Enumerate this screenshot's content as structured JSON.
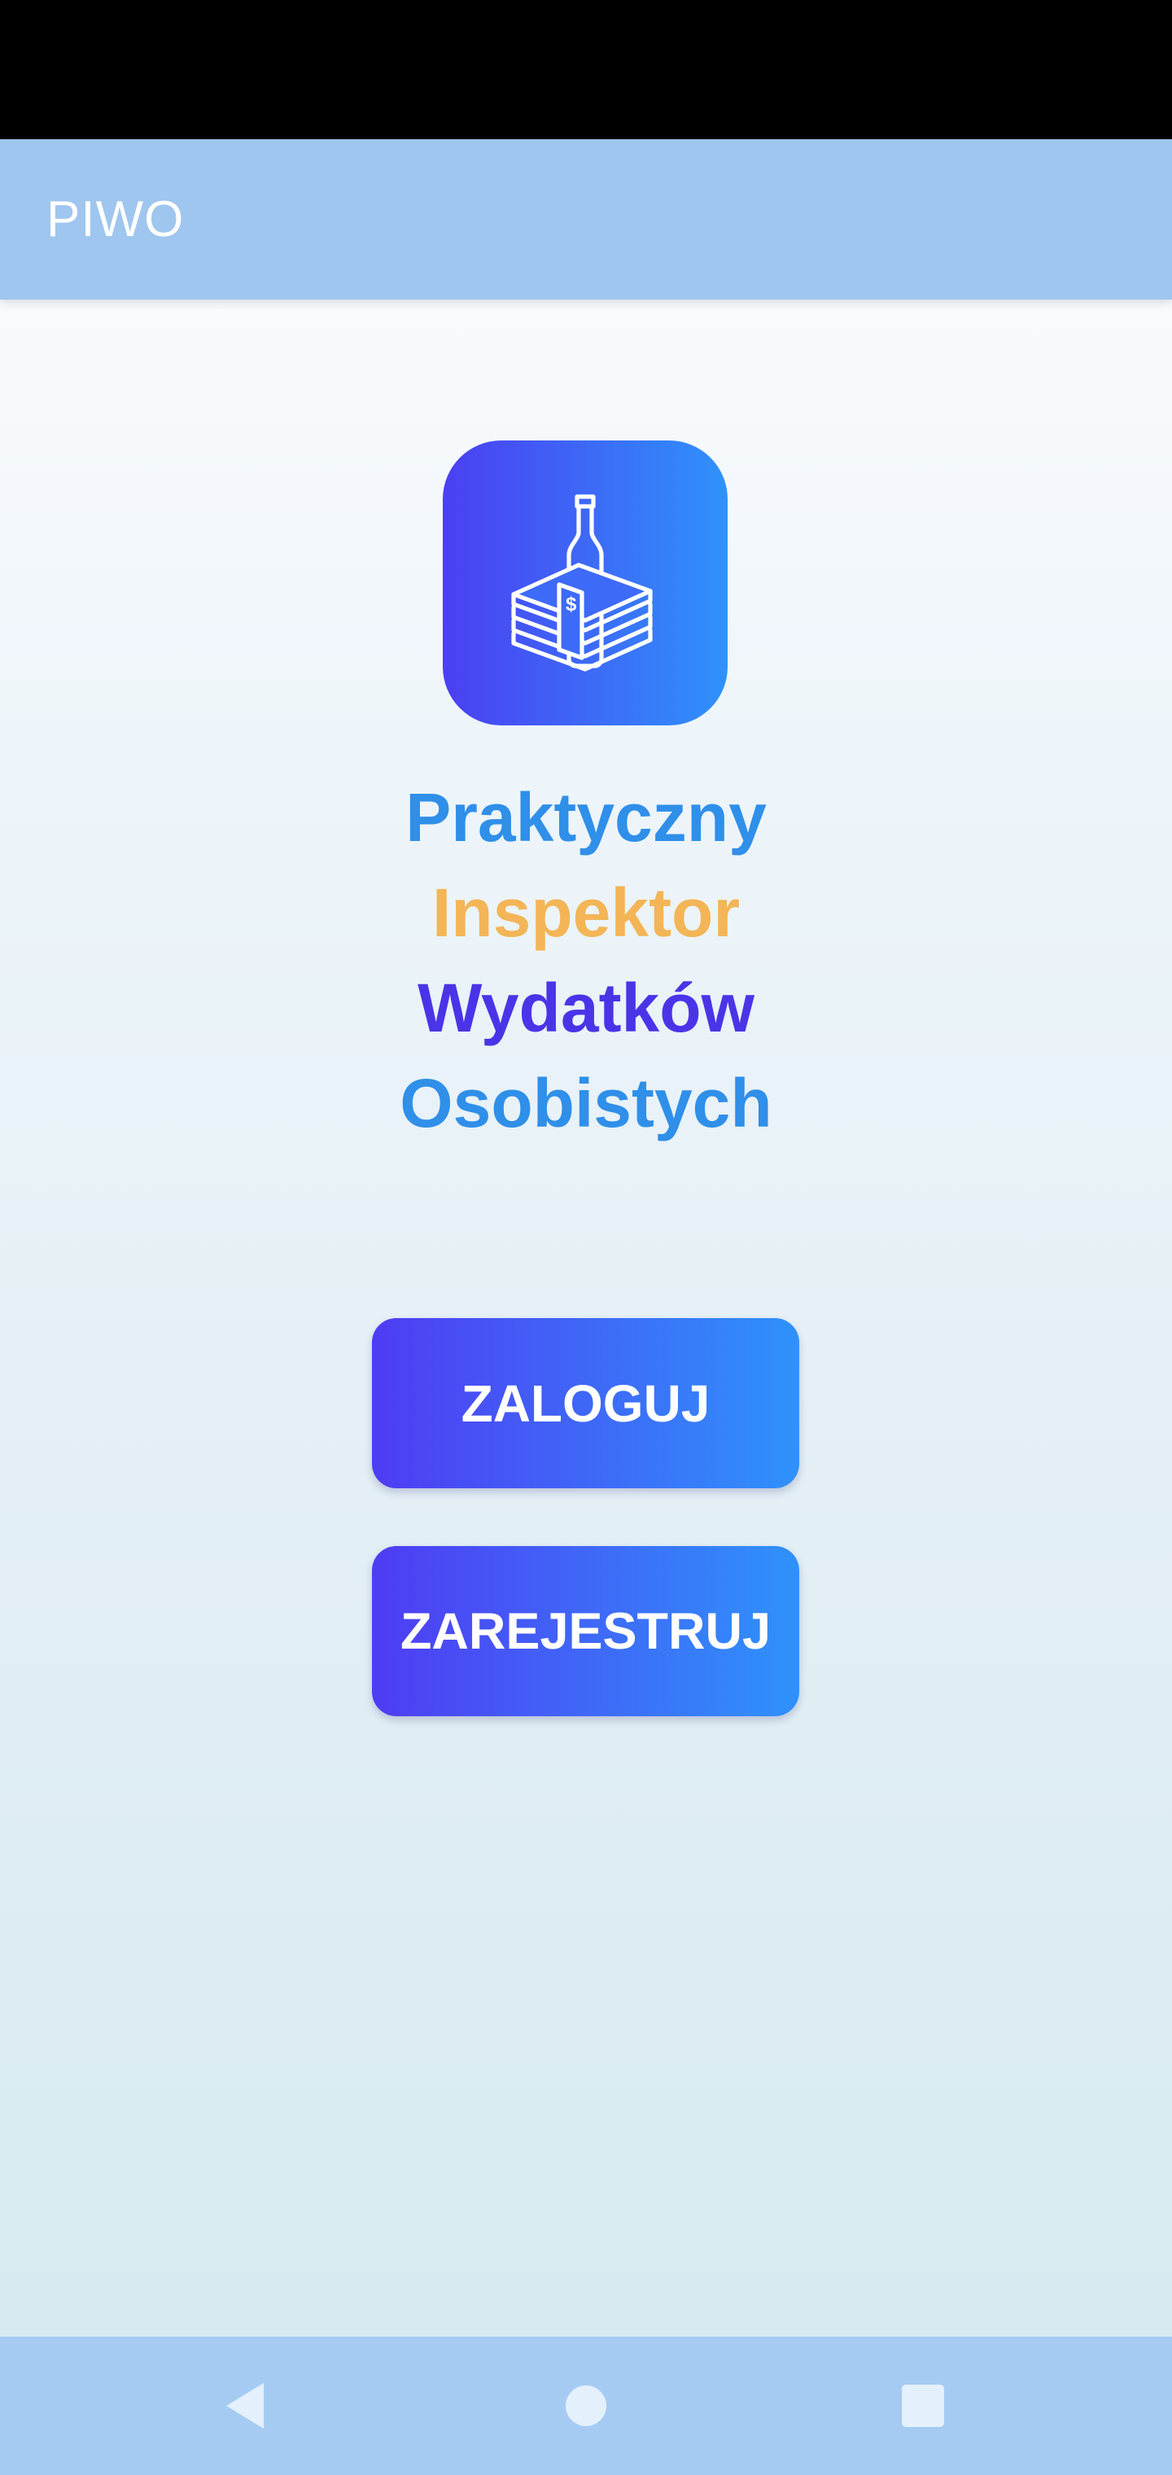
{
  "app_bar": {
    "title": "PIWO"
  },
  "logo": {
    "icon": "bottle-and-money-icon"
  },
  "headline": {
    "lines": [
      {
        "text": "Praktyczny",
        "color": "#2f8fe9"
      },
      {
        "text": "Inspektor",
        "color": "#f3b556"
      },
      {
        "text": "Wydatków",
        "color": "#4b34e8"
      },
      {
        "text": "Osobistych",
        "color": "#2f8fe9"
      }
    ]
  },
  "buttons": {
    "login_label": "ZALOGUJ",
    "register_label": "ZAREJESTRUJ"
  },
  "nav_bar": {
    "icons": [
      "back-icon",
      "home-icon",
      "recents-icon"
    ]
  },
  "colors": {
    "app_bar": "#9fc6ee",
    "nav_bar": "#a6cbf3",
    "gradient_start": "#4b3ff2",
    "gradient_end": "#2f92fb"
  }
}
